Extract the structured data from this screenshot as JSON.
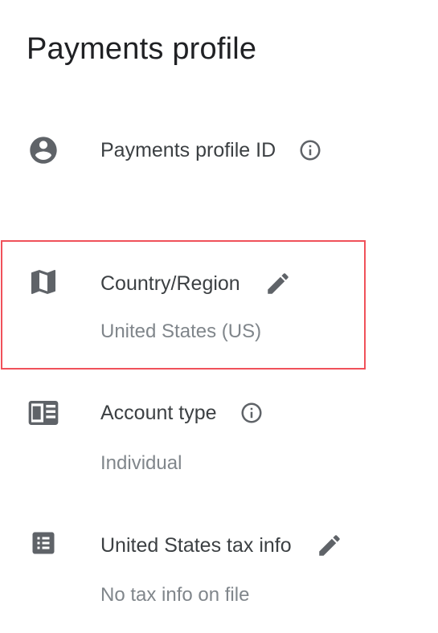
{
  "header": {
    "title": "Payments profile"
  },
  "rows": [
    {
      "icon": "account-circle-icon",
      "label": "Payments profile ID",
      "action_icon": "info-icon",
      "value": ""
    },
    {
      "icon": "map-icon",
      "label": "Country/Region",
      "action_icon": "edit-pencil-icon",
      "value": "United States (US)"
    },
    {
      "icon": "contact-card-icon",
      "label": "Account type",
      "action_icon": "info-icon",
      "value": "Individual"
    },
    {
      "icon": "list-document-icon",
      "label": "United States tax info",
      "action_icon": "edit-pencil-icon",
      "value": "No tax info on file"
    }
  ],
  "colors": {
    "icon": "#5f6368",
    "text": "#3c4043",
    "secondary_text": "#80868b",
    "highlight_border": "#f0515a"
  }
}
